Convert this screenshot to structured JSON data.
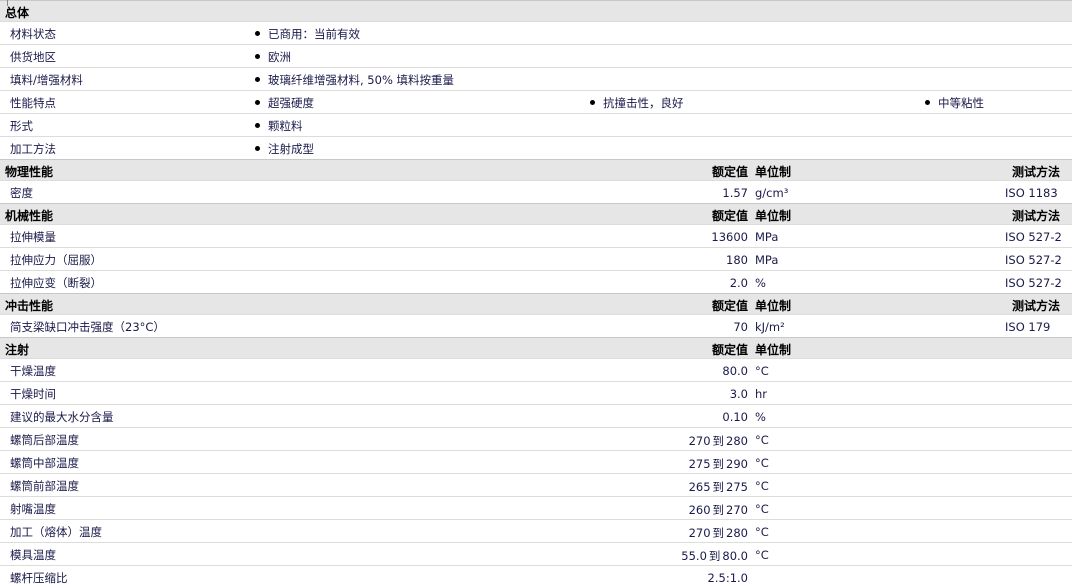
{
  "sections": {
    "general": {
      "title": "总体",
      "rows": [
        {
          "label": "材料状态",
          "items": [
            "已商用：当前有效"
          ]
        },
        {
          "label": "供货地区",
          "items": [
            "欧洲"
          ]
        },
        {
          "label": "填料/增强材料",
          "items": [
            "玻璃纤维增强材料, 50% 填料按重量"
          ]
        },
        {
          "label": "性能特点",
          "items": [
            "超强硬度",
            "抗撞击性，良好",
            "中等粘性"
          ]
        },
        {
          "label": "形式",
          "items": [
            "颗粒料"
          ]
        },
        {
          "label": "加工方法",
          "items": [
            "注射成型"
          ]
        }
      ]
    },
    "physical": {
      "title": "物理性能",
      "h_val": "额定值",
      "h_unit": "单位制",
      "h_test": "测试方法",
      "rows": [
        {
          "label": "密度",
          "val": "1.57",
          "unit": "g/cm³",
          "test": "ISO 1183"
        }
      ]
    },
    "mechanical": {
      "title": "机械性能",
      "h_val": "额定值",
      "h_unit": "单位制",
      "h_test": "测试方法",
      "rows": [
        {
          "label": "拉伸模量",
          "val": "13600",
          "unit": "MPa",
          "test": "ISO 527-2"
        },
        {
          "label": "拉伸应力（屈服）",
          "val": "180",
          "unit": "MPa",
          "test": "ISO 527-2"
        },
        {
          "label": "拉伸应变（断裂）",
          "val": "2.0",
          "unit": "%",
          "test": "ISO 527-2"
        }
      ]
    },
    "impact": {
      "title": "冲击性能",
      "h_val": "额定值",
      "h_unit": "单位制",
      "h_test": "测试方法",
      "rows": [
        {
          "label": "简支梁缺口冲击强度（23°C）",
          "val": "70",
          "unit": "kJ/m²",
          "test": "ISO 179"
        }
      ]
    },
    "injection": {
      "title": "注射",
      "h_val": "额定值",
      "h_unit": "单位制",
      "rows": [
        {
          "label": "干燥温度",
          "val": "80.0",
          "unit": "°C"
        },
        {
          "label": "干燥时间",
          "val": "3.0",
          "unit": "hr"
        },
        {
          "label": "建议的最大水分含量",
          "val": "0.10",
          "unit": "%"
        },
        {
          "label": "螺筒后部温度",
          "lo": "270",
          "to": "到",
          "hi": "280",
          "unit": "°C"
        },
        {
          "label": "螺筒中部温度",
          "lo": "275",
          "to": "到",
          "hi": "290",
          "unit": "°C"
        },
        {
          "label": "螺筒前部温度",
          "lo": "265",
          "to": "到",
          "hi": "275",
          "unit": "°C"
        },
        {
          "label": "射嘴温度",
          "lo": "260",
          "to": "到",
          "hi": "270",
          "unit": "°C"
        },
        {
          "label": "加工（熔体）温度",
          "lo": "270",
          "to": "到",
          "hi": "280",
          "unit": "°C"
        },
        {
          "label": "模具温度",
          "lo": "55.0",
          "to": "到",
          "hi": "80.0",
          "unit": "°C"
        },
        {
          "label": "螺杆压缩比",
          "val": "2.5:1.0",
          "unit": ""
        }
      ]
    }
  }
}
